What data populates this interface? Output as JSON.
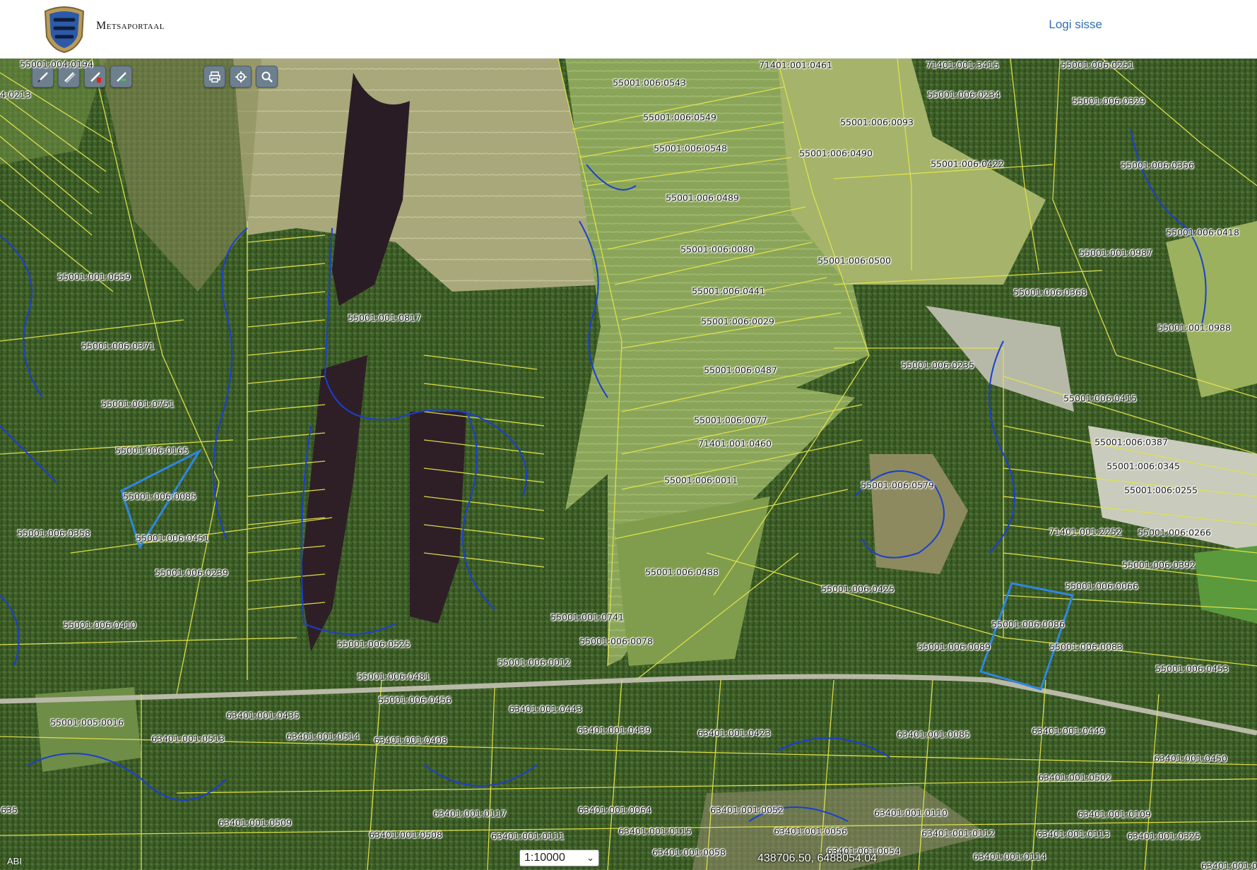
{
  "header": {
    "brand": "Metsaportaal",
    "login_label": "Logi sisse"
  },
  "map": {
    "parcels": [
      "55001:004:0194",
      "04:0213",
      "71401:001:0461",
      "71401:001:3415",
      "55001:006:0251",
      "55001:006:0543",
      "55001:006:0549",
      "55001:006:0234",
      "55001:006:0329",
      "55001:006:0093",
      "55001:006:0548",
      "55001:006:0490",
      "55001:006:0422",
      "55001:006:0356",
      "55001:006:0489",
      "55001:006:0418",
      "55001:006:0080",
      "55001:006:0500",
      "55001:001:0987",
      "55001:001:0659",
      "55001:006:0441",
      "55001:006:0368",
      "55001:001:0817",
      "55001:006:0029",
      "55001:001:0988",
      "55001:006:0371",
      "55001:006:0487",
      "55001:006:0235",
      "55001:006:0415",
      "55001:001:0751",
      "55001:006:0077",
      "55001:006:0387",
      "55001:006:0165",
      "71401:001:0460",
      "55001:006:0345",
      "55001:006:0011",
      "55001:006:0579",
      "55001:006:0255",
      "55001:006:0085",
      "55001:006:0358",
      "55001:006:0451",
      "71401:001:2252",
      "55001:006:0266",
      "55001:006:0239",
      "55001:006:0488",
      "55001:006:0392",
      "55001:006:0425",
      "55001:006:0066",
      "55001:001:0741",
      "55001:006:0410",
      "55001:006:0086",
      "55001:006:0078",
      "55001:006:0525",
      "55001:006:0089",
      "55001:006:0083",
      "55001:006:0012",
      "55001:006:0453",
      "55001:006:0481",
      "55001:006:0456",
      "63401:001:0443",
      "55001:005:0016",
      "63401:001:0435",
      "63401:001:0439",
      "63401:001:0423",
      "63401:001:0085",
      "63401:001:0449",
      "63401:001:0513",
      "63401:001:0514",
      "63401:001:0408",
      "63401:001:0450",
      "63401:001:0502",
      "635",
      "63401:001:0509",
      "63401:001:0117",
      "63401:001:0064",
      "63401:001:0052",
      "63401:001:0110",
      "63401:001:0109",
      "63401:001:0115",
      "63401:001:0056",
      "63401:001:0112",
      "63401:001:0113",
      "63401:001:0325",
      "63401:001:0508",
      "63401:001:0111",
      "63401:001:0058",
      "63401:001:0054",
      "63401:001:0114",
      "63401:001:0"
    ],
    "scale_value": "1:10000",
    "coordinates": "438706.50, 6488054.04",
    "layer_badge": "ABI"
  },
  "toolbar": {
    "left": [
      "draw-line-icon",
      "edit-line-icon",
      "delete-line-icon",
      "measure-line-icon"
    ],
    "right": [
      "print-icon",
      "locate-icon",
      "search-icon"
    ]
  },
  "colors": {
    "parcel_border": "#e3e34a",
    "forest_border": "#1a3fd1",
    "selected": "#2f86e0",
    "link": "#2f6fb0"
  }
}
